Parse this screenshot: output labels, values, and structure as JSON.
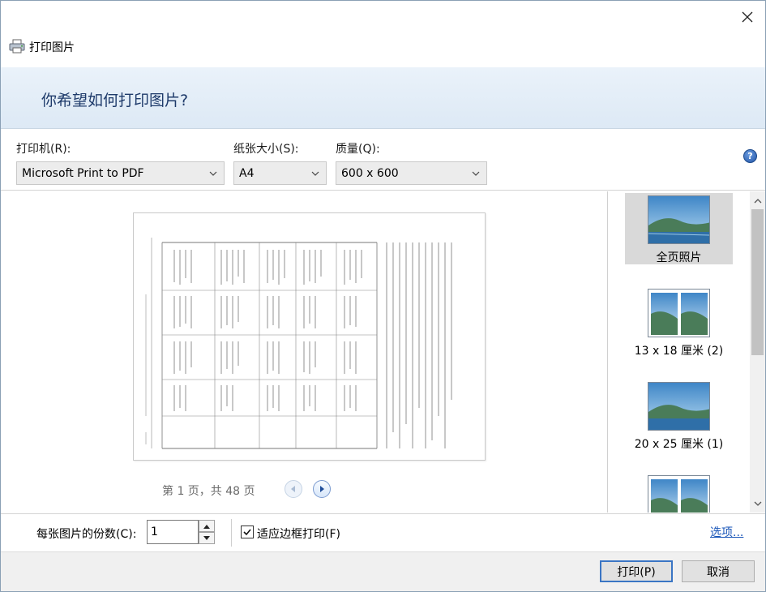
{
  "window": {
    "title": "打印图片",
    "close_glyph": "✕"
  },
  "header": {
    "question": "你希望如何打印图片?"
  },
  "printer": {
    "label": "打印机(R):",
    "value": "Microsoft Print to PDF"
  },
  "paper": {
    "label": "纸张大小(S):",
    "value": "A4"
  },
  "quality": {
    "label": "质量(Q):",
    "value": "600 x 600"
  },
  "help": {
    "glyph": "?"
  },
  "preview": {
    "page_info": "第 1 页，共 48 页"
  },
  "layouts": {
    "items": [
      {
        "label": "全页照片",
        "selected": true,
        "icon": "landscape-photo-icon"
      },
      {
        "label": "13 x 18 厘米 (2)",
        "selected": false,
        "icon": "two-photos-icon"
      },
      {
        "label": "20 x 25 厘米 (1)",
        "selected": false,
        "icon": "landscape-photo-icon"
      },
      {
        "label": "",
        "selected": false,
        "icon": "two-photos-icon"
      }
    ]
  },
  "copies": {
    "label": "每张图片的份数(C):",
    "value": "1"
  },
  "fit": {
    "label": "适应边框打印(F)",
    "checked": true
  },
  "options_link": "选项...",
  "buttons": {
    "print": "打印(P)",
    "cancel": "取消"
  },
  "colors": {
    "header_text": "#1f3b6b",
    "link": "#1a56b8",
    "selected_bg": "#d9d9d9",
    "default_button_border": "#3a75c4"
  }
}
